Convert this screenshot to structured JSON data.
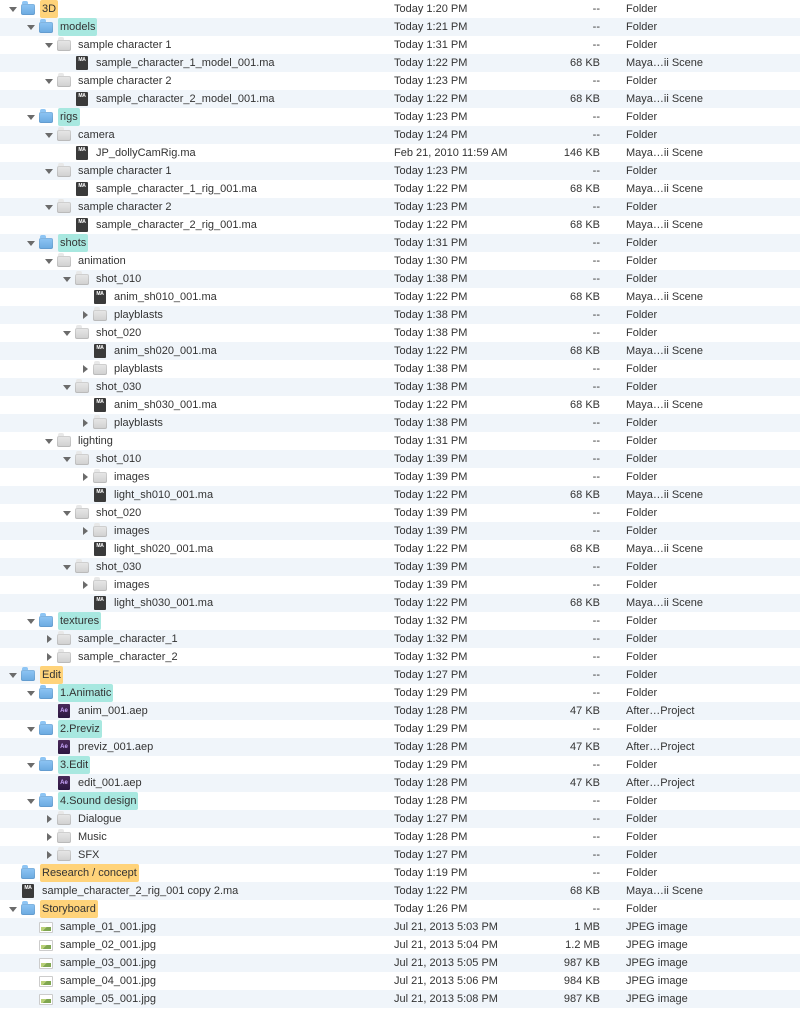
{
  "rows": [
    {
      "d": 0,
      "exp": "open",
      "icon": "folder-blue",
      "hl": "orange",
      "name": "3D",
      "date": "Today 1:20 PM",
      "size": "--",
      "kind": "Folder"
    },
    {
      "d": 1,
      "exp": "open",
      "icon": "folder-blue",
      "hl": "cyan",
      "name": "models",
      "date": "Today 1:21 PM",
      "size": "--",
      "kind": "Folder"
    },
    {
      "d": 2,
      "exp": "open",
      "icon": "folder-grey",
      "name": "sample character 1",
      "date": "Today 1:31 PM",
      "size": "--",
      "kind": "Folder"
    },
    {
      "d": 3,
      "exp": "none",
      "icon": "file-ma",
      "name": "sample_character_1_model_001.ma",
      "date": "Today 1:22 PM",
      "size": "68 KB",
      "kind": "Maya…ii Scene"
    },
    {
      "d": 2,
      "exp": "open",
      "icon": "folder-grey",
      "name": "sample character 2",
      "date": "Today 1:23 PM",
      "size": "--",
      "kind": "Folder"
    },
    {
      "d": 3,
      "exp": "none",
      "icon": "file-ma",
      "name": "sample_character_2_model_001.ma",
      "date": "Today 1:22 PM",
      "size": "68 KB",
      "kind": "Maya…ii Scene"
    },
    {
      "d": 1,
      "exp": "open",
      "icon": "folder-blue",
      "hl": "cyan",
      "name": "rigs",
      "date": "Today 1:23 PM",
      "size": "--",
      "kind": "Folder"
    },
    {
      "d": 2,
      "exp": "open",
      "icon": "folder-grey",
      "name": "camera",
      "date": "Today 1:24 PM",
      "size": "--",
      "kind": "Folder"
    },
    {
      "d": 3,
      "exp": "none",
      "icon": "file-ma",
      "name": "JP_dollyCamRig.ma",
      "date": "Feb 21, 2010 11:59 AM",
      "size": "146 KB",
      "kind": "Maya…ii Scene"
    },
    {
      "d": 2,
      "exp": "open",
      "icon": "folder-grey",
      "name": "sample character 1",
      "date": "Today 1:23 PM",
      "size": "--",
      "kind": "Folder"
    },
    {
      "d": 3,
      "exp": "none",
      "icon": "file-ma",
      "name": "sample_character_1_rig_001.ma",
      "date": "Today 1:22 PM",
      "size": "68 KB",
      "kind": "Maya…ii Scene"
    },
    {
      "d": 2,
      "exp": "open",
      "icon": "folder-grey",
      "name": "sample character 2",
      "date": "Today 1:23 PM",
      "size": "--",
      "kind": "Folder"
    },
    {
      "d": 3,
      "exp": "none",
      "icon": "file-ma",
      "name": "sample_character_2_rig_001.ma",
      "date": "Today 1:22 PM",
      "size": "68 KB",
      "kind": "Maya…ii Scene"
    },
    {
      "d": 1,
      "exp": "open",
      "icon": "folder-blue",
      "hl": "cyan",
      "name": "shots",
      "date": "Today 1:31 PM",
      "size": "--",
      "kind": "Folder"
    },
    {
      "d": 2,
      "exp": "open",
      "icon": "folder-grey",
      "name": "animation",
      "date": "Today 1:30 PM",
      "size": "--",
      "kind": "Folder"
    },
    {
      "d": 3,
      "exp": "open",
      "icon": "folder-grey",
      "name": "shot_010",
      "date": "Today 1:38 PM",
      "size": "--",
      "kind": "Folder"
    },
    {
      "d": 4,
      "exp": "none",
      "icon": "file-ma",
      "name": "anim_sh010_001.ma",
      "date": "Today 1:22 PM",
      "size": "68 KB",
      "kind": "Maya…ii Scene"
    },
    {
      "d": 4,
      "exp": "closed",
      "icon": "folder-grey",
      "name": "playblasts",
      "date": "Today 1:38 PM",
      "size": "--",
      "kind": "Folder"
    },
    {
      "d": 3,
      "exp": "open",
      "icon": "folder-grey",
      "name": "shot_020",
      "date": "Today 1:38 PM",
      "size": "--",
      "kind": "Folder"
    },
    {
      "d": 4,
      "exp": "none",
      "icon": "file-ma",
      "name": "anim_sh020_001.ma",
      "date": "Today 1:22 PM",
      "size": "68 KB",
      "kind": "Maya…ii Scene"
    },
    {
      "d": 4,
      "exp": "closed",
      "icon": "folder-grey",
      "name": "playblasts",
      "date": "Today 1:38 PM",
      "size": "--",
      "kind": "Folder"
    },
    {
      "d": 3,
      "exp": "open",
      "icon": "folder-grey",
      "name": "shot_030",
      "date": "Today 1:38 PM",
      "size": "--",
      "kind": "Folder"
    },
    {
      "d": 4,
      "exp": "none",
      "icon": "file-ma",
      "name": "anim_sh030_001.ma",
      "date": "Today 1:22 PM",
      "size": "68 KB",
      "kind": "Maya…ii Scene"
    },
    {
      "d": 4,
      "exp": "closed",
      "icon": "folder-grey",
      "name": "playblasts",
      "date": "Today 1:38 PM",
      "size": "--",
      "kind": "Folder"
    },
    {
      "d": 2,
      "exp": "open",
      "icon": "folder-grey",
      "name": "lighting",
      "date": "Today 1:31 PM",
      "size": "--",
      "kind": "Folder"
    },
    {
      "d": 3,
      "exp": "open",
      "icon": "folder-grey",
      "name": "shot_010",
      "date": "Today 1:39 PM",
      "size": "--",
      "kind": "Folder"
    },
    {
      "d": 4,
      "exp": "closed",
      "icon": "folder-grey",
      "name": "images",
      "date": "Today 1:39 PM",
      "size": "--",
      "kind": "Folder"
    },
    {
      "d": 4,
      "exp": "none",
      "icon": "file-ma",
      "name": "light_sh010_001.ma",
      "date": "Today 1:22 PM",
      "size": "68 KB",
      "kind": "Maya…ii Scene"
    },
    {
      "d": 3,
      "exp": "open",
      "icon": "folder-grey",
      "name": "shot_020",
      "date": "Today 1:39 PM",
      "size": "--",
      "kind": "Folder"
    },
    {
      "d": 4,
      "exp": "closed",
      "icon": "folder-grey",
      "name": "images",
      "date": "Today 1:39 PM",
      "size": "--",
      "kind": "Folder"
    },
    {
      "d": 4,
      "exp": "none",
      "icon": "file-ma",
      "name": "light_sh020_001.ma",
      "date": "Today 1:22 PM",
      "size": "68 KB",
      "kind": "Maya…ii Scene"
    },
    {
      "d": 3,
      "exp": "open",
      "icon": "folder-grey",
      "name": "shot_030",
      "date": "Today 1:39 PM",
      "size": "--",
      "kind": "Folder"
    },
    {
      "d": 4,
      "exp": "closed",
      "icon": "folder-grey",
      "name": "images",
      "date": "Today 1:39 PM",
      "size": "--",
      "kind": "Folder"
    },
    {
      "d": 4,
      "exp": "none",
      "icon": "file-ma",
      "name": "light_sh030_001.ma",
      "date": "Today 1:22 PM",
      "size": "68 KB",
      "kind": "Maya…ii Scene"
    },
    {
      "d": 1,
      "exp": "open",
      "icon": "folder-blue",
      "hl": "cyan",
      "name": "textures",
      "date": "Today 1:32 PM",
      "size": "--",
      "kind": "Folder"
    },
    {
      "d": 2,
      "exp": "closed",
      "icon": "folder-grey",
      "name": "sample_character_1",
      "date": "Today 1:32 PM",
      "size": "--",
      "kind": "Folder"
    },
    {
      "d": 2,
      "exp": "closed",
      "icon": "folder-grey",
      "name": "sample_character_2",
      "date": "Today 1:32 PM",
      "size": "--",
      "kind": "Folder"
    },
    {
      "d": 0,
      "exp": "open",
      "icon": "folder-blue",
      "hl": "orange",
      "name": "Edit",
      "date": "Today 1:27 PM",
      "size": "--",
      "kind": "Folder"
    },
    {
      "d": 1,
      "exp": "open",
      "icon": "folder-blue",
      "hl": "cyan",
      "name": "1.Animatic",
      "date": "Today 1:29 PM",
      "size": "--",
      "kind": "Folder"
    },
    {
      "d": 2,
      "exp": "none",
      "icon": "file-aep",
      "name": "anim_001.aep",
      "date": "Today 1:28 PM",
      "size": "47 KB",
      "kind": "After…Project"
    },
    {
      "d": 1,
      "exp": "open",
      "icon": "folder-blue",
      "hl": "cyan",
      "name": "2.Previz",
      "date": "Today 1:29 PM",
      "size": "--",
      "kind": "Folder"
    },
    {
      "d": 2,
      "exp": "none",
      "icon": "file-aep",
      "name": "previz_001.aep",
      "date": "Today 1:28 PM",
      "size": "47 KB",
      "kind": "After…Project"
    },
    {
      "d": 1,
      "exp": "open",
      "icon": "folder-blue",
      "hl": "cyan",
      "name": "3.Edit",
      "date": "Today 1:29 PM",
      "size": "--",
      "kind": "Folder"
    },
    {
      "d": 2,
      "exp": "none",
      "icon": "file-aep",
      "name": "edit_001.aep",
      "date": "Today 1:28 PM",
      "size": "47 KB",
      "kind": "After…Project"
    },
    {
      "d": 1,
      "exp": "open",
      "icon": "folder-blue",
      "hl": "cyan",
      "name": "4.Sound design",
      "date": "Today 1:28 PM",
      "size": "--",
      "kind": "Folder"
    },
    {
      "d": 2,
      "exp": "closed",
      "icon": "folder-grey",
      "name": "Dialogue",
      "date": "Today 1:27 PM",
      "size": "--",
      "kind": "Folder"
    },
    {
      "d": 2,
      "exp": "closed",
      "icon": "folder-grey",
      "name": "Music",
      "date": "Today 1:28 PM",
      "size": "--",
      "kind": "Folder"
    },
    {
      "d": 2,
      "exp": "closed",
      "icon": "folder-grey",
      "name": "SFX",
      "date": "Today 1:27 PM",
      "size": "--",
      "kind": "Folder"
    },
    {
      "d": 0,
      "exp": "none",
      "icon": "folder-blue",
      "hl": "orange",
      "name": "Research / concept",
      "date": "Today 1:19 PM",
      "size": "--",
      "kind": "Folder"
    },
    {
      "d": 0,
      "exp": "none",
      "icon": "file-ma",
      "name": "sample_character_2_rig_001 copy 2.ma",
      "date": "Today 1:22 PM",
      "size": "68 KB",
      "kind": "Maya…ii Scene"
    },
    {
      "d": 0,
      "exp": "open",
      "icon": "folder-blue",
      "hl": "orange",
      "name": "Storyboard",
      "date": "Today 1:26 PM",
      "size": "--",
      "kind": "Folder"
    },
    {
      "d": 1,
      "exp": "none",
      "icon": "file-jpg",
      "name": "sample_01_001.jpg",
      "date": "Jul 21, 2013 5:03 PM",
      "size": "1 MB",
      "kind": "JPEG image"
    },
    {
      "d": 1,
      "exp": "none",
      "icon": "file-jpg",
      "name": "sample_02_001.jpg",
      "date": "Jul 21, 2013 5:04 PM",
      "size": "1.2 MB",
      "kind": "JPEG image"
    },
    {
      "d": 1,
      "exp": "none",
      "icon": "file-jpg",
      "name": "sample_03_001.jpg",
      "date": "Jul 21, 2013 5:05 PM",
      "size": "987 KB",
      "kind": "JPEG image"
    },
    {
      "d": 1,
      "exp": "none",
      "icon": "file-jpg",
      "name": "sample_04_001.jpg",
      "date": "Jul 21, 2013 5:06 PM",
      "size": "984 KB",
      "kind": "JPEG image"
    },
    {
      "d": 1,
      "exp": "none",
      "icon": "file-jpg",
      "name": "sample_05_001.jpg",
      "date": "Jul 21, 2013 5:08 PM",
      "size": "987 KB",
      "kind": "JPEG image"
    }
  ]
}
